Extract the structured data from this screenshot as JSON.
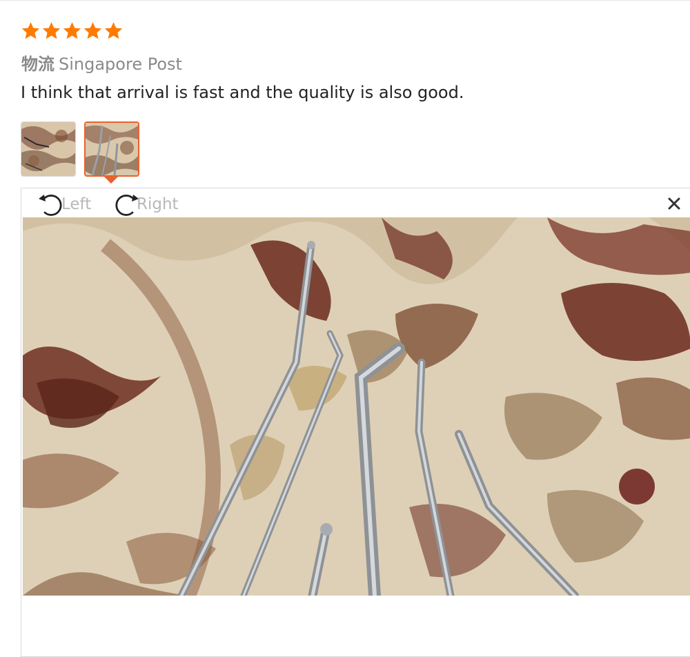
{
  "review": {
    "rating": 5,
    "max_rating": 5,
    "star_color": "#ff7a00",
    "logistics_label": "物流",
    "logistics_value": "Singapore Post",
    "text": "I think that arrival is fast and the quality is also good."
  },
  "thumbnails": {
    "selected_index": 1,
    "count": 2,
    "selected_border_color": "#e8622f"
  },
  "viewer": {
    "rotate_left_label": "Left",
    "rotate_right_label": "Right",
    "icons": {
      "rotate_left": "rotate-left-icon",
      "rotate_right": "rotate-right-icon",
      "close": "close-icon"
    }
  }
}
